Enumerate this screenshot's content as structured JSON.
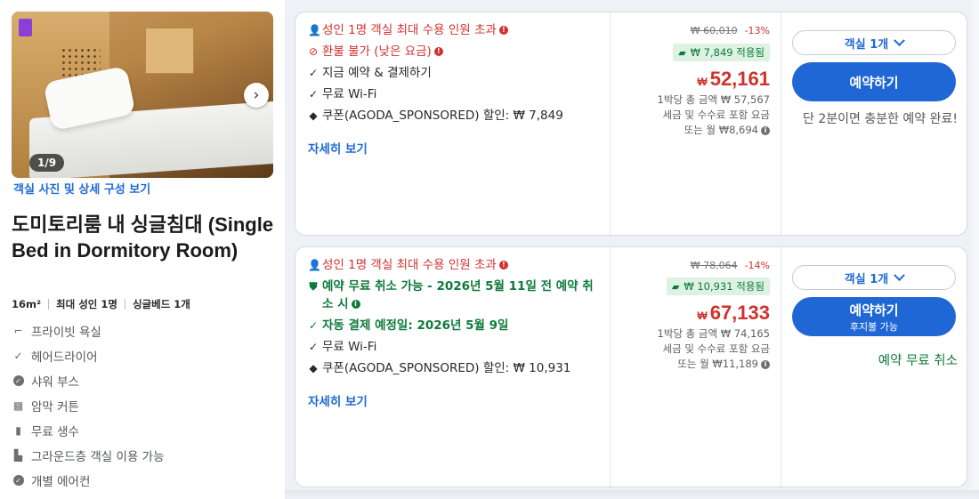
{
  "room": {
    "photo_counter": "1/9",
    "photo_link": "객실 사진 및 상세 구성 보기",
    "title": "도미토리룸 내 싱글침대 (Single Bed in Dormitory Room)",
    "specs": [
      "16m²",
      "최대 성인 1명",
      "싱글베드 1개"
    ],
    "features": [
      {
        "icon": "shower-icon",
        "label": "프라이빗 욕실"
      },
      {
        "icon": "check-icon",
        "label": "헤어드라이어"
      },
      {
        "icon": "check-circle-icon",
        "label": "샤워 부스"
      },
      {
        "icon": "blackout-curtain-icon",
        "label": "암막 커튼"
      },
      {
        "icon": "water-bottle-icon",
        "label": "무료 생수"
      },
      {
        "icon": "ground-floor-icon",
        "label": "그라운드층 객실 이용 가능"
      },
      {
        "icon": "check-circle-icon",
        "label": "개별 에어컨"
      }
    ]
  },
  "offers": [
    {
      "conditions": [
        {
          "icon": "person-icon",
          "text": "성인 1명 객실 최대 수용 인원 초과",
          "style": "red",
          "info": true
        },
        {
          "icon": "no-refund-icon",
          "text": "환불 불가 (낮은 요금)",
          "style": "red",
          "info": true
        },
        {
          "icon": "check-icon",
          "text": "지금 예약 & 결제하기",
          "style": "normal",
          "info": false
        },
        {
          "icon": "check-icon",
          "text": "무료 Wi-Fi",
          "style": "normal",
          "info": false
        },
        {
          "icon": "tag-icon",
          "text": "쿠폰(AGODA_SPONSORED) 할인: ₩ 7,849",
          "style": "normal",
          "info": false
        }
      ],
      "more_link": "자세히 보기",
      "original_price": "₩ 60,010",
      "discount_pct": "-13%",
      "coupon_applied": "₩ 7,849 적용됨",
      "currency": "₩",
      "price": "52,161",
      "sub_lines": [
        "1박당 총 금액 ₩ 57,567",
        "세금 및 수수료 포함 요금",
        "또는 월 ₩8,694"
      ],
      "room_select": "객실 1개",
      "book_label": "예약하기",
      "book_sub": "",
      "urgency": "단 2분이면 충분한 예약 완료!"
    },
    {
      "conditions": [
        {
          "icon": "person-icon",
          "text": "성인 1명 객실 최대 수용 인원 초과",
          "style": "red",
          "info": true
        },
        {
          "icon": "shield-check-icon",
          "text": "예약 무료 취소 가능 - 2026년 5월 11일 전 예약 취소 시",
          "style": "greenb",
          "info": true
        },
        {
          "icon": "check-icon",
          "text": "자동 결제 예정일: 2026년 5월 9일",
          "style": "greenb",
          "info": false
        },
        {
          "icon": "check-icon",
          "text": "무료 Wi-Fi",
          "style": "normal",
          "info": false
        },
        {
          "icon": "tag-icon",
          "text": "쿠폰(AGODA_SPONSORED) 할인: ₩ 10,931",
          "style": "normal",
          "info": false
        }
      ],
      "more_link": "자세히 보기",
      "original_price": "₩ 78,064",
      "discount_pct": "-14%",
      "coupon_applied": "₩ 10,931 적용됨",
      "currency": "₩",
      "price": "67,133",
      "sub_lines": [
        "1박당 총 금액 ₩ 74,165",
        "세금 및 수수료 포함 요금",
        "또는 월 ₩11,189"
      ],
      "room_select": "객실 1개",
      "book_label": "예약하기",
      "book_sub": "후지불 가능",
      "free_cancel": "예약 무료 취소"
    }
  ],
  "colors": {
    "accent": "#2067d6",
    "price_red": "#d0312d",
    "green": "#0e7a3a"
  }
}
